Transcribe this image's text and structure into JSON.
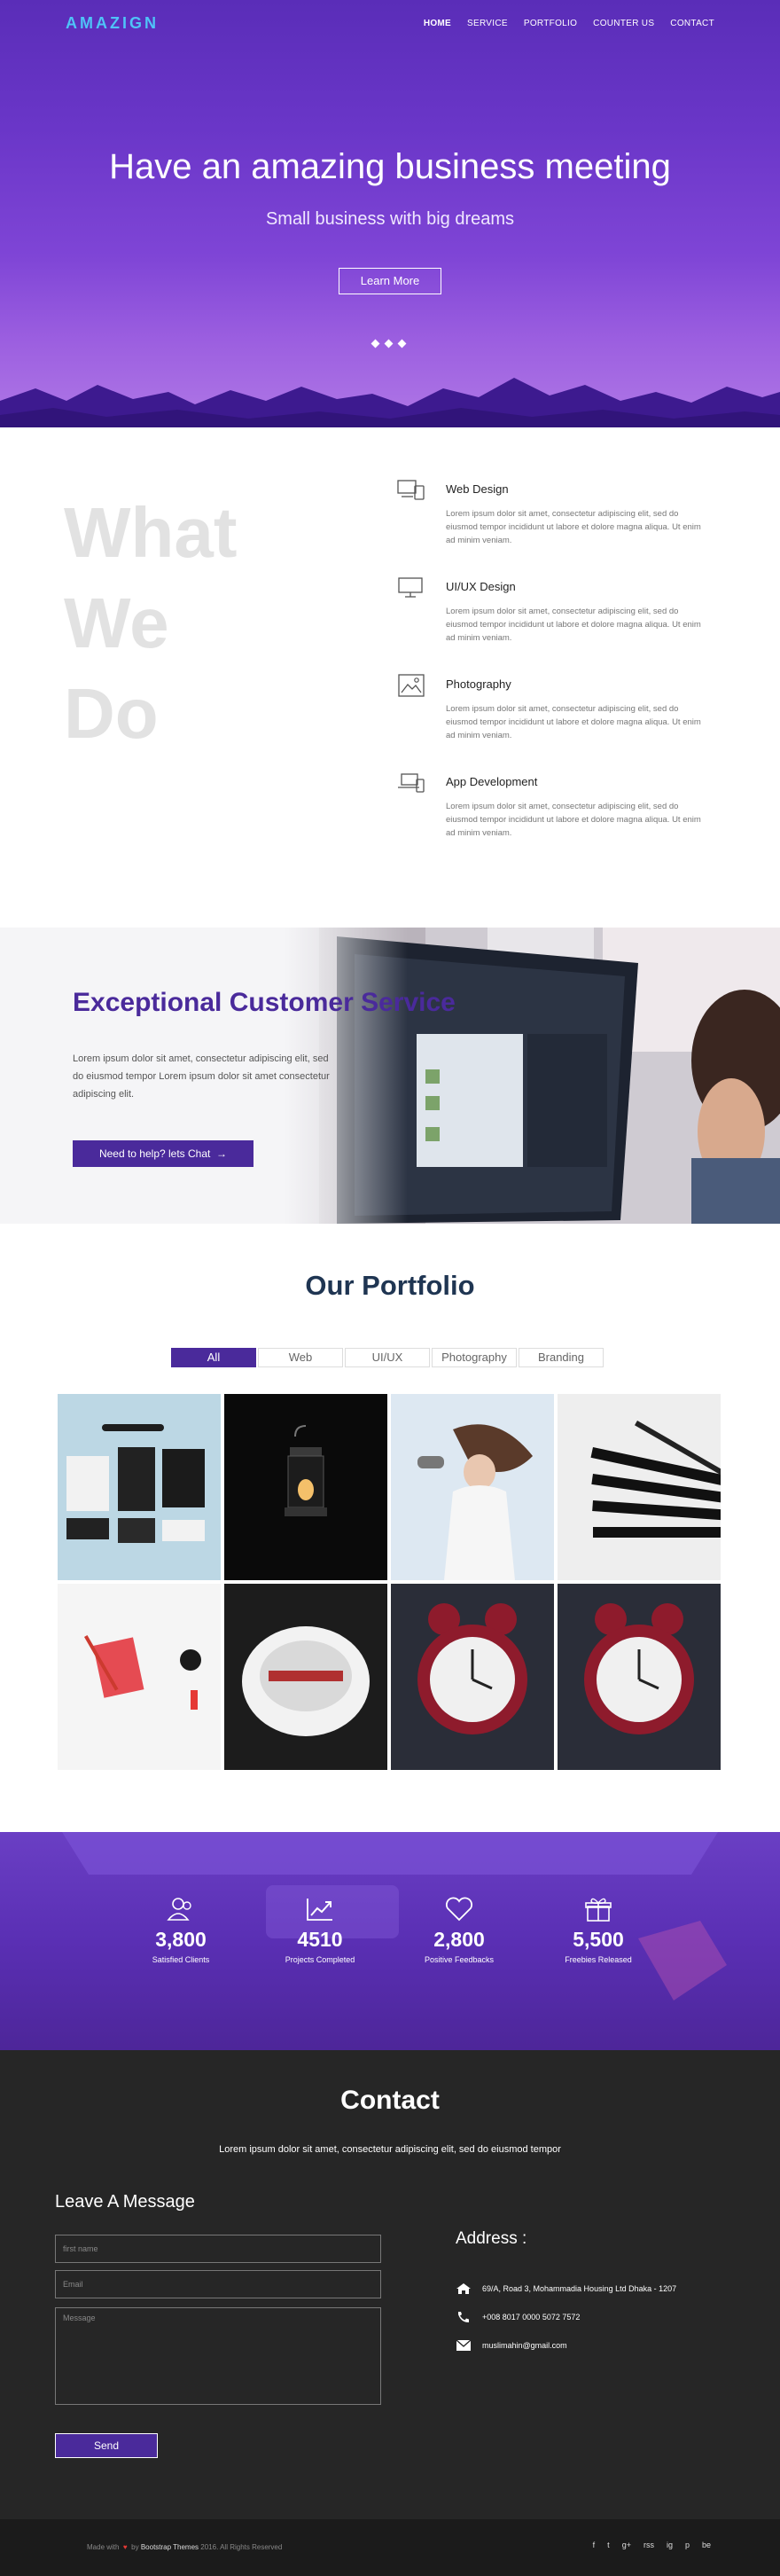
{
  "nav": {
    "logo": "AMAZIGN",
    "links": [
      "HOME",
      "SERVICE",
      "PORTFOLIO",
      "COUNTER US",
      "CONTACT"
    ]
  },
  "hero": {
    "title": "Have an amazing business meeting",
    "subtitle": "Small business with big dreams",
    "button": "Learn More"
  },
  "what_we_do": {
    "heading": [
      "What",
      "We",
      "Do"
    ],
    "services": [
      {
        "icon": "devices-icon",
        "title": "Web Design",
        "text": "Lorem ipsum dolor sit amet, consectetur adipiscing elit, sed do eiusmod tempor incididunt ut labore et dolore magna aliqua. Ut enim ad minim veniam."
      },
      {
        "icon": "monitor-icon",
        "title": "UI/UX Design",
        "text": "Lorem ipsum dolor sit amet, consectetur adipiscing elit, sed do eiusmod tempor incididunt ut labore et dolore magna aliqua. Ut enim ad minim veniam."
      },
      {
        "icon": "image-icon",
        "title": "Photography",
        "text": "Lorem ipsum dolor sit amet, consectetur adipiscing elit, sed do eiusmod tempor incididunt ut labore et dolore magna aliqua. Ut enim ad minim veniam."
      },
      {
        "icon": "laptop-phone-icon",
        "title": "App Development",
        "text": "Lorem ipsum dolor sit amet, consectetur adipiscing elit, sed do eiusmod tempor incididunt ut labore et dolore magna aliqua. Ut enim ad minim veniam."
      }
    ]
  },
  "customer_service": {
    "title": "Exceptional Customer Service",
    "text": "Lorem ipsum dolor sit amet, consectetur adipiscing elit, sed do eiusmod tempor Lorem ipsum dolor sit amet consectetur adipiscing elit.",
    "button": "Need to help? lets Chat"
  },
  "portfolio": {
    "title": "Our Portfolio",
    "filters": [
      "All",
      "Web",
      "UI/UX",
      "Photography",
      "Branding"
    ],
    "active_filter": "All"
  },
  "counters": [
    {
      "icon": "users-icon",
      "value": "3,800",
      "label": "Satisfied Clients"
    },
    {
      "icon": "chart-icon",
      "value": "4510",
      "label": "Projects Completed"
    },
    {
      "icon": "heart-icon",
      "value": "2,800",
      "label": "Positive Feedbacks"
    },
    {
      "icon": "gift-icon",
      "value": "5,500",
      "label": "Freebies Released"
    }
  ],
  "contact": {
    "title": "Contact",
    "subtitle": "Lorem ipsum dolor sit amet, consectetur adipiscing elit, sed do eiusmod tempor",
    "form_title": "Leave A Message",
    "placeholders": {
      "name": "first name",
      "email": "Email",
      "message": "Message"
    },
    "send": "Send",
    "address_title": "Address :",
    "address": "69/A, Road 3, Mohammadia Housing Ltd Dhaka - 1207",
    "phone": "+008 8017 0000 5072 7572",
    "email": "muslimahin@gmail.com"
  },
  "footer": {
    "made_with": "Made with",
    "by": "by",
    "brand": "Bootstrap Themes",
    "copyright": "2016. All Rights Reserved",
    "social": [
      "f",
      "t",
      "g+",
      "rss",
      "ig",
      "p",
      "be"
    ]
  },
  "colors": {
    "primary": "#4a2a9b",
    "hero": "#6a36c8",
    "dark": "#262626",
    "logo": "#4fc3f7"
  }
}
